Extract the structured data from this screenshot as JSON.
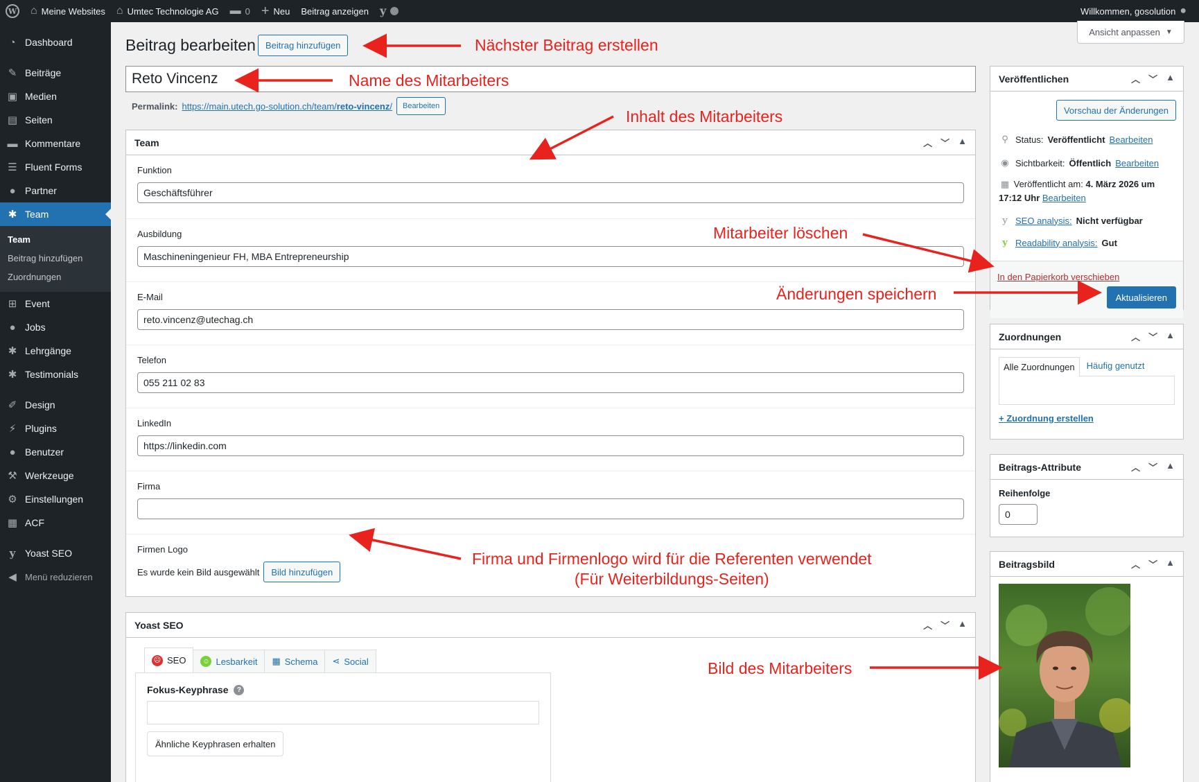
{
  "adminbar": {
    "my_sites": "Meine Websites",
    "site_name": "Umtec Technologie AG",
    "comments_count": "0",
    "new": "Neu",
    "view_post": "Beitrag anzeigen",
    "greeting": "Willkommen, gosolution"
  },
  "sidebar": {
    "items_top": [
      {
        "icon": "dashboard-icon",
        "glyph": "◔",
        "label": "Dashboard"
      }
    ],
    "items_main": [
      {
        "icon": "pin-icon",
        "glyph": "✎",
        "label": "Beiträge"
      },
      {
        "icon": "media-icon",
        "glyph": "▣",
        "label": "Medien"
      },
      {
        "icon": "pages-icon",
        "glyph": "▤",
        "label": "Seiten"
      },
      {
        "icon": "comments-icon",
        "glyph": "▬",
        "label": "Kommentare"
      },
      {
        "icon": "forms-icon",
        "glyph": "☰",
        "label": "Fluent Forms"
      },
      {
        "icon": "user-icon",
        "glyph": "●",
        "label": "Partner"
      }
    ],
    "current": {
      "icon": "groups-icon",
      "glyph": "✱",
      "label": "Team"
    },
    "submenu": [
      "Team",
      "Beitrag hinzufügen",
      "Zuordnungen"
    ],
    "items_after": [
      {
        "icon": "sitemap-icon",
        "glyph": "⊞",
        "label": "Event"
      },
      {
        "icon": "user-icon",
        "glyph": "●",
        "label": "Jobs"
      },
      {
        "icon": "groups-icon",
        "glyph": "✱",
        "label": "Lehrgänge"
      },
      {
        "icon": "groups-icon",
        "glyph": "✱",
        "label": "Testimonials"
      }
    ],
    "items_admin": [
      {
        "icon": "brush-icon",
        "glyph": "✐",
        "label": "Design"
      },
      {
        "icon": "plugin-icon",
        "glyph": "⚡",
        "label": "Plugins"
      },
      {
        "icon": "user-icon",
        "glyph": "●",
        "label": "Benutzer"
      },
      {
        "icon": "wrench-icon",
        "glyph": "⚒",
        "label": "Werkzeuge"
      },
      {
        "icon": "settings-icon",
        "glyph": "⚙",
        "label": "Einstellungen"
      },
      {
        "icon": "acf-icon",
        "glyph": "▦",
        "label": "ACF"
      }
    ],
    "yoast": "Yoast SEO",
    "collapse": "Menü reduzieren"
  },
  "screen_options": "Ansicht anpassen",
  "page": {
    "title": "Beitrag bearbeiten",
    "add_new": "Beitrag hinzufügen",
    "post_title": "Reto Vincenz",
    "permalink_label": "Permalink:",
    "permalink_base": "https://main.utech.go-solution.ch/team/",
    "permalink_slug": "reto-vincenz",
    "permalink_trail": "/",
    "permalink_edit": "Bearbeiten"
  },
  "team_box": {
    "title": "Team",
    "fields": [
      {
        "label": "Funktion",
        "value": "Geschäftsführer"
      },
      {
        "label": "Ausbildung",
        "value": "Maschineningenieur FH, MBA Entrepreneurship"
      },
      {
        "label": "E-Mail",
        "value": "reto.vincenz@utechag.ch"
      },
      {
        "label": "Telefon",
        "value": "055 211 02 83"
      },
      {
        "label": "LinkedIn",
        "value": "https://linkedin.com"
      },
      {
        "label": "Firma",
        "value": ""
      }
    ],
    "logo_label": "Firmen Logo",
    "logo_none": "Es wurde kein Bild ausgewählt",
    "logo_add": "Bild hinzufügen"
  },
  "yoast_box": {
    "title": "Yoast SEO",
    "tabs": [
      "SEO",
      "Lesbarkeit",
      "Schema",
      "Social"
    ],
    "focus_label": "Fokus-Keyphrase",
    "related_button": "Ähnliche Keyphrasen erhalten"
  },
  "publish": {
    "title": "Veröffentlichen",
    "preview": "Vorschau der Änderungen",
    "status_label": "Status:",
    "status_value": "Veröffentlicht",
    "visibility_label": "Sichtbarkeit:",
    "visibility_value": "Öffentlich",
    "published_label": "Veröffentlicht am:",
    "published_value_1": "4. März 2026 um",
    "published_value_2": "17:12 Uhr",
    "edit": "Bearbeiten",
    "seo_label": "SEO analysis:",
    "seo_value": "Nicht verfügbar",
    "readability_label": "Readability analysis:",
    "readability_value": "Gut",
    "trash": "In den Papierkorb verschieben",
    "update": "Aktualisieren"
  },
  "categories": {
    "title": "Zuordnungen",
    "tab_all": "Alle Zuordnungen",
    "tab_popular": "Häufig genutzt",
    "add": "+ Zuordnung erstellen"
  },
  "attributes": {
    "title": "Beitrags-Attribute",
    "order_label": "Reihenfolge",
    "order_value": "0"
  },
  "thumbnail": {
    "title": "Beitragsbild"
  },
  "annotations": {
    "next_post": "Nächster Beitrag erstellen",
    "employee_name": "Name des Mitarbeiters",
    "employee_content": "Inhalt des Mitarbeiters",
    "delete_employee": "Mitarbeiter löschen",
    "save_changes": "Änderungen speichern",
    "company_line1": "Firma und Firmenlogo wird für die Referenten verwendet",
    "company_line2": "(Für Weiterbildungs-Seiten)",
    "employee_image": "Bild des Mitarbeiters"
  },
  "colors": {
    "wp_blue": "#2271b1",
    "admin_dark": "#1d2327",
    "annotation_red": "#e8231d",
    "trash_red": "#b32d2e",
    "good_green": "#7ad03a"
  }
}
